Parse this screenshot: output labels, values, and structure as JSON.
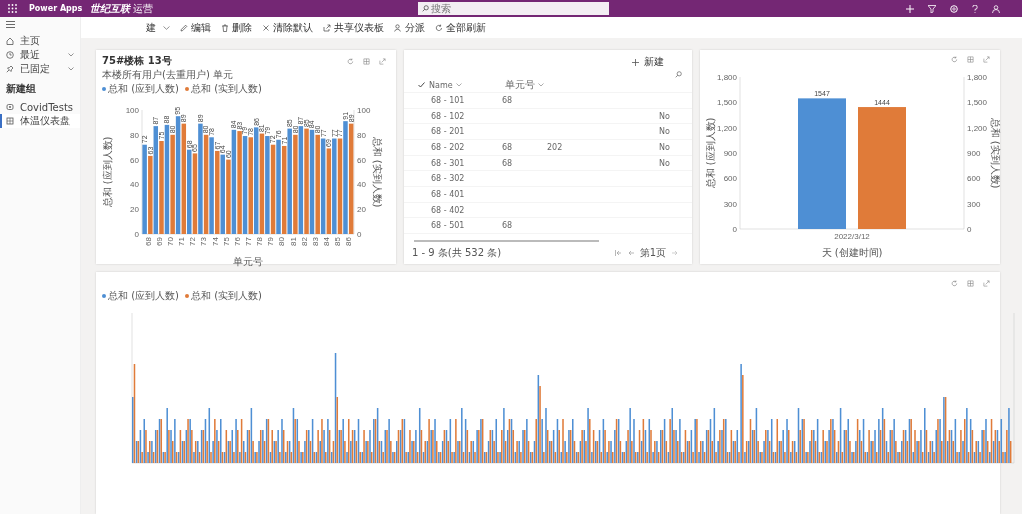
{
  "app_bar": {
    "app_name": "Power Apps",
    "org_name": "世纪互联",
    "org_suffix": "运营",
    "search_placeholder": "搜索"
  },
  "toolbar": [
    {
      "kind": "new",
      "label": "建"
    },
    {
      "kind": "edit",
      "label": "编辑"
    },
    {
      "kind": "delete",
      "label": "删除"
    },
    {
      "kind": "clear",
      "label": "清除默认"
    },
    {
      "kind": "share",
      "label": "共享仪表板"
    },
    {
      "kind": "assign",
      "label": "分派"
    },
    {
      "kind": "refresh",
      "label": "全部刷新"
    }
  ],
  "sidebar": {
    "items": [
      {
        "kind": "home",
        "label": "主页",
        "expandable": false,
        "selected": false
      },
      {
        "kind": "recent",
        "label": "最近",
        "expandable": true,
        "selected": false
      },
      {
        "kind": "pin",
        "label": "已固定",
        "expandable": true,
        "selected": false
      }
    ],
    "group_label": "新建组",
    "group_items": [
      {
        "kind": "covid",
        "label": "CovidTests",
        "selected": false
      },
      {
        "kind": "dashboard",
        "label": "体温仪表盘",
        "selected": true
      }
    ]
  },
  "units_chart": {
    "title": "75#楼栋 13号",
    "subtitle": "本楼所有用户(去重用户) 单元",
    "right_ticks": [
      "100",
      "80",
      "60",
      "40",
      "20",
      "0"
    ],
    "right_axis_label": "总和 (实到人数)",
    "chart_data": {
      "type": "bar",
      "xlabel": "单元号",
      "ylabel": "总和 (应到人数)",
      "categories": [
        "68",
        "69",
        "70",
        "71",
        "72",
        "73",
        "74",
        "75",
        "76",
        "77",
        "78",
        "79",
        "80",
        "81",
        "82",
        "83",
        "84",
        "85",
        "86"
      ],
      "series": [
        {
          "name": "总和 (应到人数)",
          "color": "#4e8fd4",
          "values": [
            72,
            87,
            88,
            95,
            68,
            89,
            78,
            64,
            84,
            79,
            86,
            79,
            76,
            85,
            87,
            84,
            77,
            77,
            91
          ]
        },
        {
          "name": "总和 (实到人数)",
          "color": "#e07b39",
          "values": [
            63,
            75,
            80,
            89,
            65,
            80,
            67,
            60,
            83,
            78,
            81,
            72,
            71,
            80,
            85,
            80,
            69,
            77,
            89
          ]
        }
      ],
      "ylim": [
        0,
        100
      ],
      "yticks": [
        {
          "value": 0,
          "label": "0"
        },
        {
          "value": 20,
          "label": "20"
        },
        {
          "value": 40,
          "label": "40"
        },
        {
          "value": 60,
          "label": "60"
        },
        {
          "value": 80,
          "label": "80"
        },
        {
          "value": 100,
          "label": "100"
        }
      ],
      "data_labels": true
    }
  },
  "units_table": {
    "new_button": "新建",
    "columns": [
      "Name",
      "单元号"
    ],
    "rows": [
      {
        "name": "68 - 101",
        "unit": "68",
        "column_3": "",
        "column_4": ""
      },
      {
        "name": "68 - 102",
        "unit": "",
        "column_3": "",
        "column_4": "No"
      },
      {
        "name": "68 - 201",
        "unit": "",
        "column_3": "",
        "column_4": "No"
      },
      {
        "name": "68 - 202",
        "unit": "68",
        "column_3": "202",
        "column_4": "No"
      },
      {
        "name": "68 - 301",
        "unit": "68",
        "column_3": "",
        "column_4": "No"
      },
      {
        "name": "68 - 302",
        "unit": "",
        "column_3": "",
        "column_4": ""
      },
      {
        "name": "68 - 401",
        "unit": "",
        "column_3": "",
        "column_4": ""
      },
      {
        "name": "68 - 402",
        "unit": "",
        "column_3": "",
        "column_4": ""
      },
      {
        "name": "68 - 501",
        "unit": "68",
        "column_3": "",
        "column_4": ""
      }
    ],
    "footer": "1 - 9 条(共 532 条)",
    "page": "第1页"
  },
  "daily_chart": {
    "right_ticks": [
      "1,800",
      "1,500",
      "1,200",
      "900",
      "600",
      "300",
      "0"
    ],
    "right_axis_label": "总和 (实到人数)",
    "chart_data": {
      "type": "bar",
      "xlabel": "天 (创建时间)",
      "ylabel": "总和 (应到人数)",
      "categories": [
        "2022/3/12"
      ],
      "series": [
        {
          "color": "#4e8fd4",
          "values": [
            1547
          ]
        },
        {
          "color": "#e07b39",
          "values": [
            1444
          ]
        }
      ],
      "ylim": [
        0,
        1800
      ],
      "yticks": [
        0,
        300,
        600,
        900,
        {
          "value": 1200,
          "label": "1,200"
        },
        {
          "value": 1500,
          "label": "1,500"
        },
        {
          "value": 1800,
          "label": "1,800"
        }
      ],
      "data_labels": true
    }
  },
  "detail_chart": {
    "legend": [
      {
        "label": "总和 (应到人数)",
        "color": "#4e8fd4"
      },
      {
        "label": "总和 (实到人数)",
        "color": "#e07b39"
      }
    ]
  }
}
